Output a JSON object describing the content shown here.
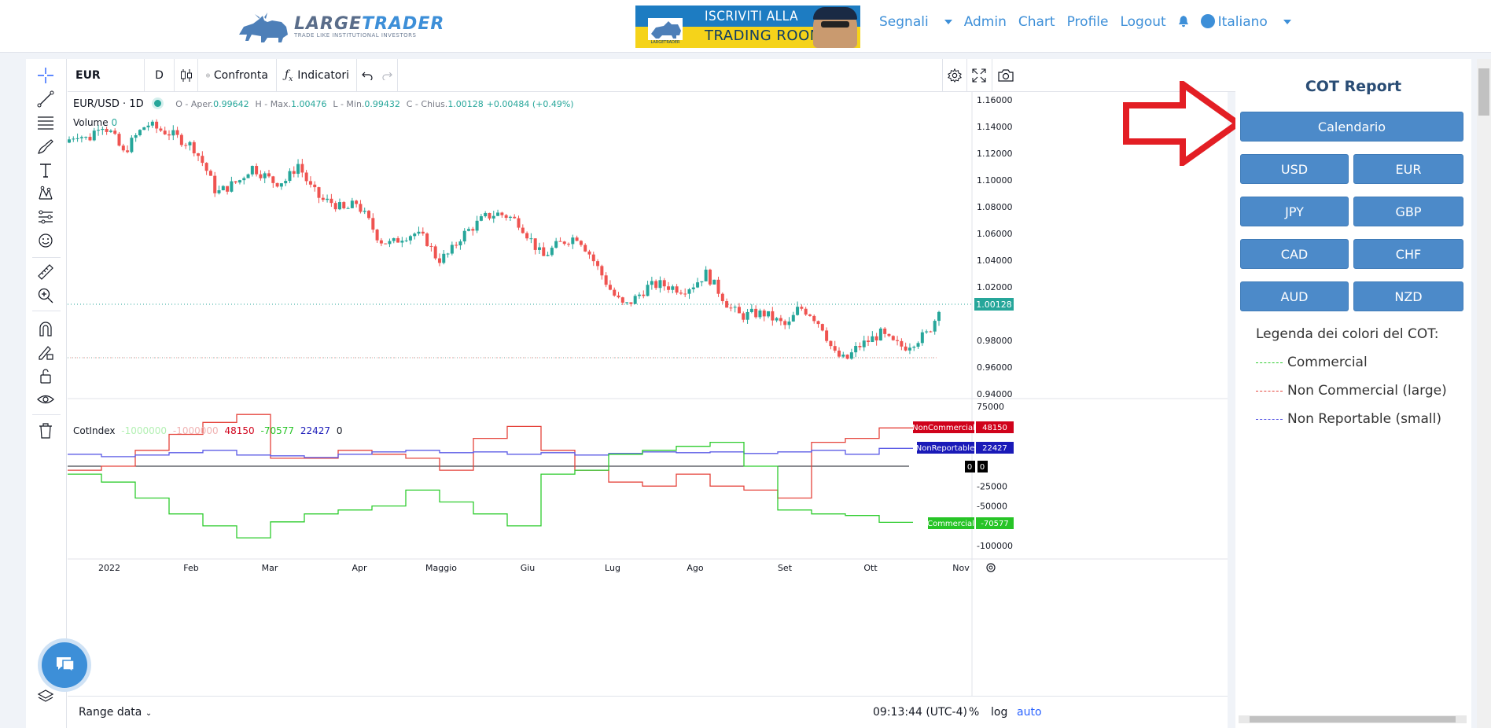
{
  "navbar": {
    "logo_main": "LARGE",
    "logo_accent": "TRADER",
    "logo_sub": "TRADE LIKE INSTITUTIONAL INVESTORS",
    "banner_line1": "ISCRIVITI ALLA",
    "banner_line2": "TRADING ROOM",
    "banner_badge": "LARGETRADER",
    "menu": [
      "Segnali",
      "Admin",
      "Chart",
      "Profile",
      "Logout"
    ],
    "language": "Italiano"
  },
  "toolbar": {
    "symbol": "EUR",
    "interval": "D",
    "compare_label": "Confronta",
    "indicators_label": "Indicatori"
  },
  "legend": {
    "symbol_line": "EUR/USD · 1D",
    "open_label": "O - Aper.",
    "open": "0.99642",
    "high_label": "H - Max.",
    "high": "1.00476",
    "low_label": "L - Min.",
    "low": "0.99432",
    "close_label": "C - Chius.",
    "close": "1.00128",
    "change": "+0.00484 (+0.49%)",
    "volume_label": "Volume",
    "volume": "0"
  },
  "indicator_legend": {
    "name": "CotIndex",
    "v1": "-1000000",
    "v2": "-1000000",
    "v3": "48150",
    "v4": "-70577",
    "v5": "22427",
    "v6": "0"
  },
  "price_axis": [
    "1.16000",
    "1.14000",
    "1.12000",
    "1.10000",
    "1.08000",
    "1.06000",
    "1.04000",
    "1.02000",
    "0.98000",
    "0.96000",
    "0.94000"
  ],
  "price_label": "1.00128",
  "cot_axis": [
    "75000",
    "-25000",
    "-50000",
    "-100000"
  ],
  "cot_tags": {
    "noncommercial_name": "NonCommercial",
    "noncommercial_value": "48150",
    "nonreportable_name": "NonReportable",
    "nonreportable_value": "22427",
    "zero_a": "0",
    "zero_b": "0",
    "commercial_name": "Commercial",
    "commercial_value": "-70577"
  },
  "time_axis": [
    "2022",
    "Feb",
    "Mar",
    "Apr",
    "Maggio",
    "Giu",
    "Lug",
    "Ago",
    "Set",
    "Ott",
    "Nov"
  ],
  "bottom": {
    "range_label": "Range data",
    "clock": "09:13:44 (UTC-4)",
    "pct": "%",
    "log": "log",
    "auto": "auto"
  },
  "cot_panel": {
    "title": "COT Report",
    "calendar": "Calendario",
    "currencies": [
      "USD",
      "EUR",
      "JPY",
      "GBP",
      "CAD",
      "CHF",
      "AUD",
      "NZD"
    ],
    "legend_title": "Legenda dei colori del COT:",
    "legend_items": [
      "Commercial",
      "Non Commercial (large)",
      "Non Reportable (small)"
    ]
  },
  "colors": {
    "up": "#26a69a",
    "down": "#ef5350",
    "commercial": "#2ecc2e",
    "noncommercial": "#e5443c",
    "nonreportable": "#5c5ce6",
    "accent": "#3d8fd8",
    "arrow": "#e31e24"
  },
  "chart_data": [
    {
      "type": "candlestick",
      "title": "EUR/USD · 1D",
      "x": [
        "2022",
        "Feb",
        "Mar",
        "Apr",
        "Maggio",
        "Giu",
        "Lug",
        "Ago",
        "Set",
        "Ott",
        "Nov"
      ],
      "ylim": [
        0.94,
        1.16
      ],
      "close_path": [
        1.128,
        1.135,
        1.13,
        1.143,
        1.135,
        1.12,
        1.132,
        1.142,
        1.138,
        1.135,
        1.13,
        1.125,
        1.11,
        1.09,
        1.095,
        1.1,
        1.11,
        1.104,
        1.098,
        1.1,
        1.112,
        1.095,
        1.085,
        1.083,
        1.077,
        1.083,
        1.07,
        1.055,
        1.052,
        1.058,
        1.06,
        1.055,
        1.04,
        1.045,
        1.058,
        1.065,
        1.072,
        1.075,
        1.073,
        1.068,
        1.055,
        1.042,
        1.05,
        1.055,
        1.058,
        1.045,
        1.03,
        1.015,
        1.005,
        1.012,
        1.02,
        1.022,
        1.02,
        1.018,
        1.022,
        1.03,
        1.018,
        1.005,
        0.998,
        1.0,
        1.0,
        0.995,
        0.99,
        1.005,
        1.0,
        0.99,
        0.97,
        0.965,
        0.975,
        0.98,
        0.985,
        0.978,
        0.975,
        0.98,
        0.985,
        1.0013
      ]
    },
    {
      "type": "line",
      "title": "CotIndex",
      "ylim": [
        -100000,
        75000
      ],
      "series": [
        {
          "name": "NonCommercial",
          "values": [
            -5000,
            0,
            20000,
            40000,
            55000,
            65000,
            10000,
            10000,
            20000,
            15000,
            10000,
            -5000,
            35000,
            50000,
            20000,
            -5000,
            -20000,
            -25000,
            -10000,
            -25000,
            -30000,
            -40000,
            30000,
            35000,
            48150
          ]
        },
        {
          "name": "NonReportable",
          "values": [
            15000,
            12000,
            14000,
            17000,
            20000,
            14000,
            13000,
            11000,
            15000,
            18000,
            20000,
            17000,
            18000,
            15000,
            17000,
            14000,
            16000,
            18000,
            17000,
            18000,
            16000,
            18000,
            20000,
            15000,
            22427
          ]
        },
        {
          "name": "Commercial",
          "values": [
            -10000,
            -20000,
            -40000,
            -60000,
            -75000,
            -90000,
            -70000,
            -60000,
            -55000,
            -50000,
            -30000,
            -45000,
            -60000,
            -75000,
            -10000,
            -5000,
            15000,
            20000,
            25000,
            30000,
            0,
            -55000,
            -60000,
            -62000,
            -70577
          ]
        },
        {
          "name": "0",
          "values": [
            0
          ]
        }
      ],
      "legend": "right"
    }
  ]
}
